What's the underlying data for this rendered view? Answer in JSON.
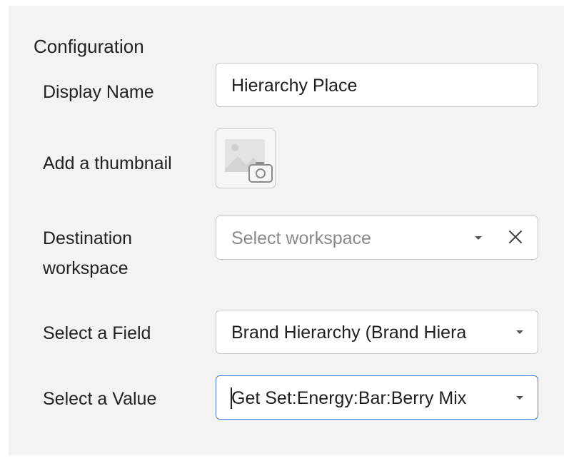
{
  "config": {
    "title": "Configuration",
    "display_name": {
      "label": "Display Name",
      "value": "Hierarchy Place"
    },
    "thumbnail": {
      "label": "Add a thumbnail",
      "icon": "image-camera-icon"
    },
    "destination": {
      "label_line1": "Destination",
      "label_line2": "workspace",
      "placeholder": "Select workspace"
    },
    "field": {
      "label": "Select a Field",
      "value": "Brand Hierarchy (Brand Hiera"
    },
    "value": {
      "label": "Select a Value",
      "value": "Get Set:Energy:Bar:Berry Mix"
    }
  },
  "colors": {
    "panel": "#f3f3f3",
    "border": "#c9c9c9",
    "focus": "#4a7fd6"
  }
}
